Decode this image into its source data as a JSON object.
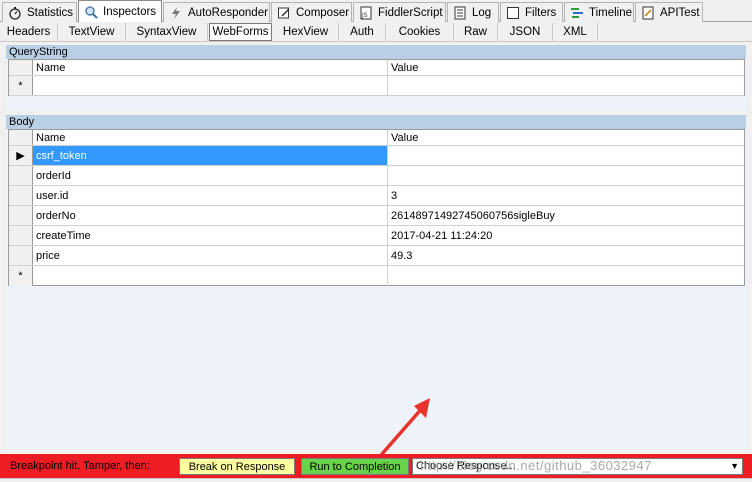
{
  "tabs": [
    {
      "label": "Statistics",
      "icon": "stopwatch-icon"
    },
    {
      "label": "Inspectors",
      "icon": "magnifier-icon"
    },
    {
      "label": "AutoResponder",
      "icon": "lightning-icon"
    },
    {
      "label": "Composer",
      "icon": "composer-icon"
    },
    {
      "label": "FiddlerScript",
      "icon": "script-icon"
    },
    {
      "label": "Log",
      "icon": "log-icon"
    },
    {
      "label": "Filters",
      "icon": "checkbox-icon"
    },
    {
      "label": "Timeline",
      "icon": "timeline-icon"
    },
    {
      "label": "APITest",
      "icon": "apitest-icon"
    }
  ],
  "subtabs": [
    "Headers",
    "TextView",
    "SyntaxView",
    "WebForms",
    "HexView",
    "Auth",
    "Cookies",
    "Raw",
    "JSON",
    "XML"
  ],
  "querystring": {
    "title": "QueryString",
    "col_name": "Name",
    "col_value": "Value",
    "new_row_marker": "*"
  },
  "body": {
    "title": "Body",
    "col_name": "Name",
    "col_value": "Value",
    "current_row_marker": "▶",
    "new_row_marker": "*",
    "rows": [
      {
        "name": "csrf_token",
        "value": ""
      },
      {
        "name": "orderId",
        "value": ""
      },
      {
        "name": "user.id",
        "value": "3"
      },
      {
        "name": "orderNo",
        "value": "26148971492745060756sigleBuy"
      },
      {
        "name": "createTime",
        "value": "2017-04-21 11:24:20"
      },
      {
        "name": "price",
        "value": "49.3"
      }
    ]
  },
  "breakpoint": {
    "text": "Breakpoint hit. Tamper, then:",
    "break_on_response": "Break on Response",
    "run_to_completion": "Run to Completion",
    "choose_response": "Choose Response...",
    "watermark": "http://blog.csdn.net/github_36032947"
  },
  "colors": {
    "bar_red": "#ee1d24",
    "break_btn": "#ffffa0",
    "run_btn": "#6ad34c",
    "selection": "#3399ff",
    "section_header": "#b9cfe4",
    "arrow": "#e8322c"
  }
}
